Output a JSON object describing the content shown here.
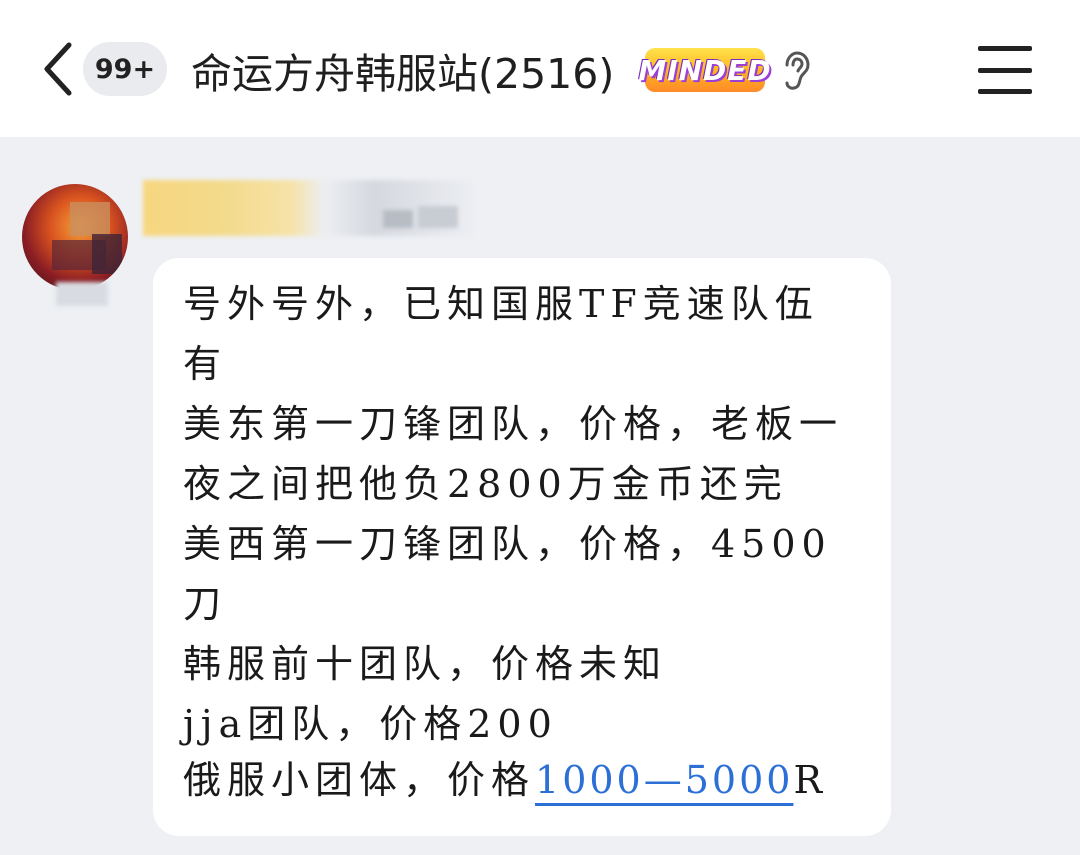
{
  "header": {
    "back_icon": "chevron-left-icon",
    "unread_badge": "99+",
    "title": "命运方舟韩服站(2516)",
    "group_badge_text": "MINDED",
    "ear_icon": "ear-icon",
    "menu_icon": "hamburger-menu-icon"
  },
  "message": {
    "lines": [
      "号外号外，已知国服TF竞速队伍",
      "有",
      "美东第一刀锋团队，价格，老板一",
      "夜之间把他负2800万金币还完",
      "美西第一刀锋团队，价格，4500",
      "刀",
      "韩服前十团队，价格未知",
      "jja团队，价格200"
    ],
    "last_line_prefix": "俄服小团体，价格",
    "last_line_link": "1000—5000",
    "last_line_suffix": "R"
  },
  "colors": {
    "background": "#eef0f4",
    "topbar": "#ffffff",
    "bubble": "#ffffff",
    "link": "#2c6fd6"
  }
}
